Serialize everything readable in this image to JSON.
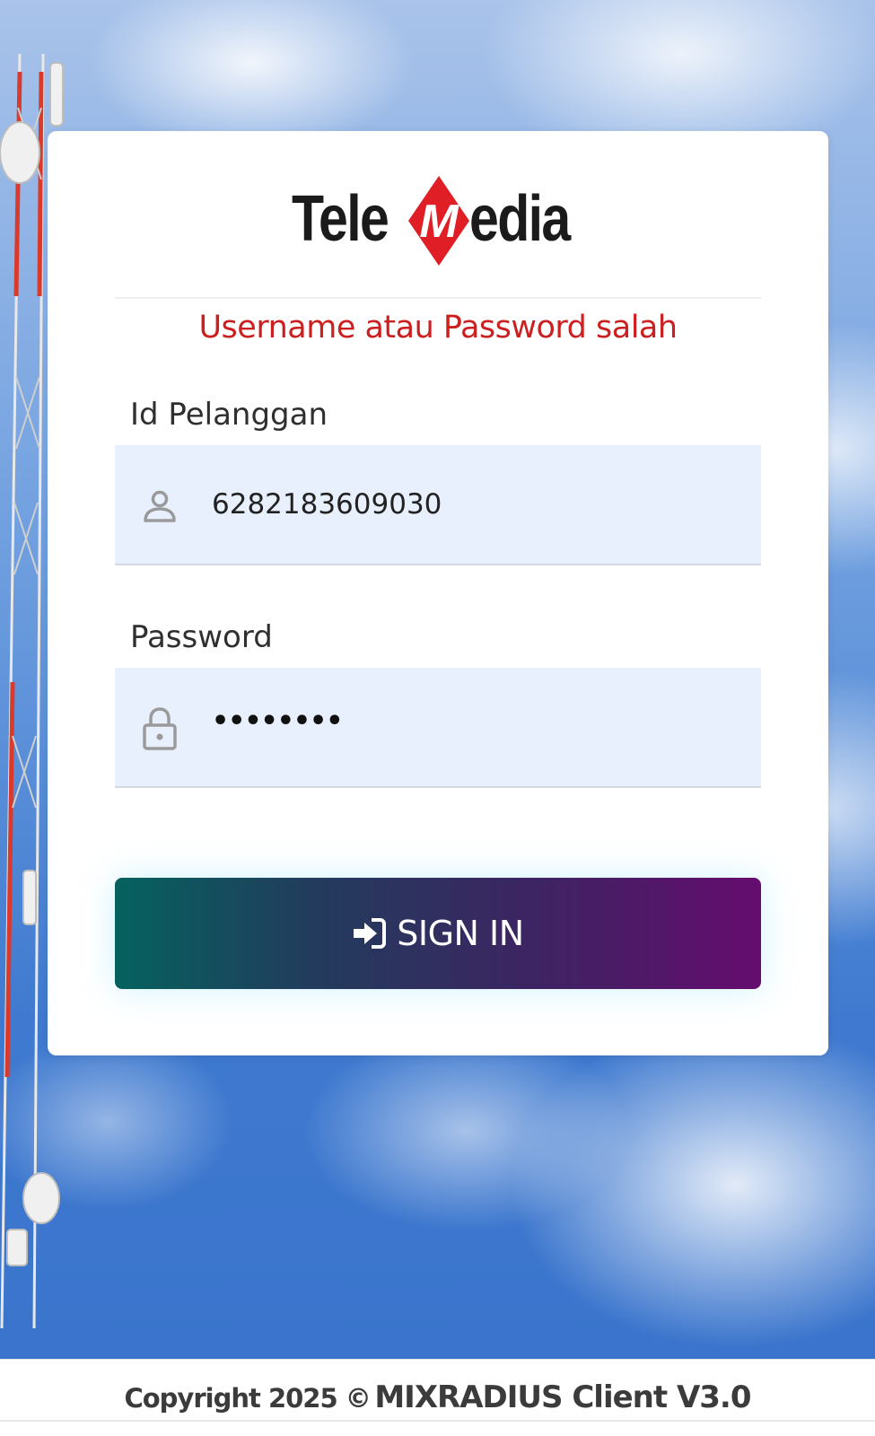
{
  "brand": {
    "logo_text_left": "Tele",
    "logo_text_right": "edia",
    "logo_mark_letter": "M",
    "logo_color": "#e01e26"
  },
  "login": {
    "error_message": "Username atau Password salah",
    "id_label": "Id Pelanggan",
    "id_value": "6282183609030",
    "password_label": "Password",
    "password_masked": "••••••••",
    "sign_in_label": "SIGN IN",
    "icons": {
      "id": "user-icon",
      "password": "lock-icon",
      "sign_in": "sign-in-icon"
    }
  },
  "footer": {
    "copyright": "Copyright 2025 ©",
    "product": "MIXRADIUS Client V3.0"
  },
  "colors": {
    "error": "#cc1f1f",
    "input_bg": "#e8f0fe",
    "button_gradient_start": "#05625e",
    "button_gradient_end": "#650c6f"
  }
}
